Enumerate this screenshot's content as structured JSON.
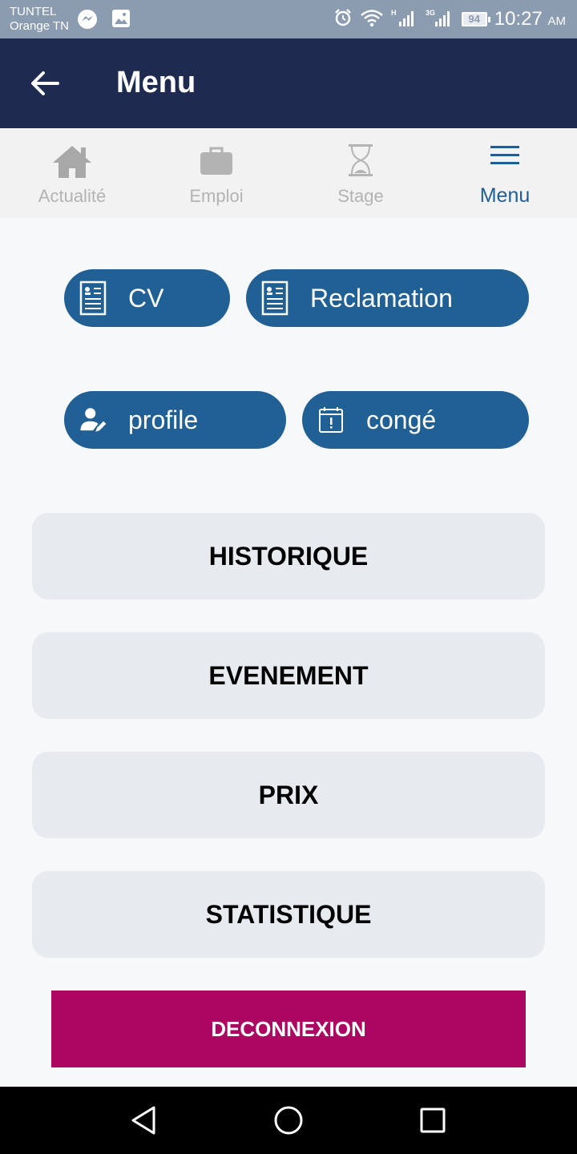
{
  "status_bar": {
    "carrier_line1": "TUNTEL",
    "carrier_line2": "Orange TN",
    "battery": "94",
    "time": "10:27",
    "ampm": "AM",
    "icons": [
      "messenger-icon",
      "image-icon",
      "alarm-icon",
      "wifi-icon",
      "signal-h-icon",
      "signal-3g-icon",
      "battery-icon"
    ]
  },
  "app_bar": {
    "title": "Menu",
    "back_icon": "arrow-left-icon"
  },
  "tabs": [
    {
      "label": "Actualité",
      "icon": "home-icon"
    },
    {
      "label": "Emploi",
      "icon": "briefcase-icon"
    },
    {
      "label": "Stage",
      "icon": "hourglass-icon"
    },
    {
      "label": "Menu",
      "icon": "menu-icon",
      "active": true
    }
  ],
  "quick_actions": [
    {
      "label": "CV",
      "icon": "document-icon"
    },
    {
      "label": "Reclamation",
      "icon": "document-icon"
    },
    {
      "label": "profile",
      "icon": "user-edit-icon"
    },
    {
      "label": "congé",
      "icon": "calendar-alert-icon"
    }
  ],
  "menu_items": [
    "HISTORIQUE",
    "EVENEMENT",
    "PRIX",
    "STATISTIQUE"
  ],
  "logout_label": "DECONNEXION",
  "colors": {
    "app_bar": "#1e2a4f",
    "accent": "#216094",
    "logout": "#ac0660",
    "card": "#e7eaef",
    "status_bar": "#8b9bb0"
  }
}
